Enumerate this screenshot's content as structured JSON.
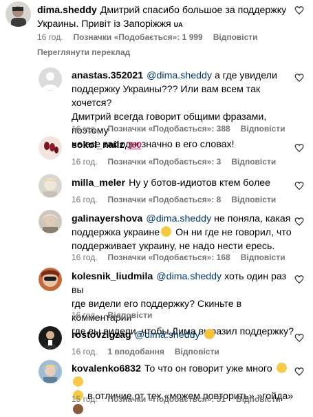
{
  "top": {
    "user": "dima.sheddy",
    "text_line1": "Дмитрий спасибо большое за поддержку",
    "text_line2": "Украины. Привіт із Запоріжжя",
    "flag": "UA",
    "time": "16 год.",
    "likes": "Позначки «Подобається»: 1 999",
    "reply": "Відповісти",
    "translate": "Переглянути переклад"
  },
  "replies": [
    {
      "user": "anastas.352021",
      "mention": "@dima.sheddy",
      "line1": "а где увидели",
      "line2": "поддержку Украины??? Или вам всем так хочется?",
      "line3": "Дмитрий всегда говорит общими фразами, поэтому",
      "line4": "не все так однозначно в его словах!",
      "time": "16 год.",
      "likes": "Позначки «Подобається»: 388",
      "reply": "Відповісти"
    },
    {
      "user": "sokol_nailz",
      "emoji": "hundred-points-icon",
      "time": "16 год.",
      "likes": "Позначки «Подобається»: 3",
      "reply": "Відповісти"
    },
    {
      "user": "milla_meler",
      "line1": "Ну у ботов-идиотов ктем более",
      "time": "16 год.",
      "likes": "Позначки «Подобається»: 8",
      "reply": "Відповісти"
    },
    {
      "user": "galinayershova",
      "mention": "@dima.sheddy",
      "line1": "не поняла, какая",
      "line2a": "поддержка украине",
      "line2b": "Он ни где не говорил, что",
      "line3": "поддерживает украину, не надо нести ересь.",
      "time": "16 год.",
      "likes": "Позначки «Подобається»: 168",
      "reply": "Відповісти"
    },
    {
      "user": "kolesnik_liudmila",
      "mention": "@dima.sheddy",
      "line1": "хоть один раз вы",
      "line2": "где видели его поддержку? Скиньте в комментарии",
      "line3": "где вы видели ,чтобы Дима выразил поддержку?",
      "time": "16 год.",
      "reply": "Відповісти"
    },
    {
      "user": "rostovzigzag",
      "mention": "@dima.sheddy",
      "time": "16 год.",
      "likes": "1 вподобання",
      "reply": "Відповісти"
    },
    {
      "user": "kovalenko6832",
      "line1": "То что он говорит уже много",
      "line2": "в отличие от тех «можем повторить»,»гойда»",
      "time": "15 год.",
      "likes": "Позначки «Подобається»: 51",
      "reply": "Відповісти"
    }
  ],
  "colors": {
    "mention": "#00376b",
    "meta": "#737373",
    "heart_stroke": "#262626"
  }
}
